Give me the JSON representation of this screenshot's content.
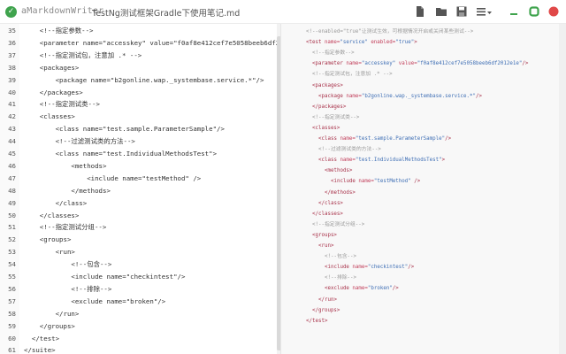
{
  "app": {
    "logo_glyph": "✓",
    "name": "aMarkdownWriter",
    "document_title": "TestNg测试框架Gradle下使用笔记.md"
  },
  "toolbar": {
    "icons": [
      "new-file-icon",
      "open-folder-icon",
      "save-icon",
      "menu-icon"
    ],
    "window_icons": [
      "minimize-icon",
      "maximize-icon",
      "close-icon"
    ]
  },
  "editor": {
    "lines": [
      {
        "n": "35",
        "text": "    <!--指定参数-->"
      },
      {
        "n": "36",
        "text": "    <parameter name=\"accesskey\" value=\"f0af8e412cef7e5058beeb6df2012"
      },
      {
        "n": "37",
        "text": "    <!--指定测试包，注意加 .* -->"
      },
      {
        "n": "38",
        "text": "    <packages>"
      },
      {
        "n": "39",
        "text": "        <package name=\"b2gonline.wap._systembase.service.*\"/>"
      },
      {
        "n": "40",
        "text": "    </packages>"
      },
      {
        "n": "41",
        "text": "    <!--指定测试类-->"
      },
      {
        "n": "42",
        "text": "    <classes>"
      },
      {
        "n": "43",
        "text": "        <class name=\"test.sample.ParameterSample\"/>"
      },
      {
        "n": "44",
        "text": "        <!--过滤测试类的方法-->"
      },
      {
        "n": "45",
        "text": "        <class name=\"test.IndividualMethodsTest\">"
      },
      {
        "n": "46",
        "text": "            <methods>"
      },
      {
        "n": "47",
        "text": "                <include name=\"testMethod\" />"
      },
      {
        "n": "48",
        "text": "            </methods>"
      },
      {
        "n": "49",
        "text": "        </class>"
      },
      {
        "n": "50",
        "text": "    </classes>"
      },
      {
        "n": "51",
        "text": "    <!--指定测试分组-->"
      },
      {
        "n": "52",
        "text": "    <groups>"
      },
      {
        "n": "53",
        "text": "        <run>"
      },
      {
        "n": "54",
        "text": "            <!--包含-->"
      },
      {
        "n": "55",
        "text": "            <include name=\"checkintest\"/>"
      },
      {
        "n": "56",
        "text": "            <!--排除-->"
      },
      {
        "n": "57",
        "text": "            <exclude name=\"broken\"/>"
      },
      {
        "n": "58",
        "text": "        </run>"
      },
      {
        "n": "59",
        "text": "    </groups>"
      },
      {
        "n": "60",
        "text": "  </test>"
      },
      {
        "n": "61",
        "text": "</suite>"
      }
    ]
  },
  "preview": {
    "lines": [
      {
        "indent": 0,
        "parts": [
          {
            "t": "<!--enabled=\"true\"让测试生效，可根据情况开启或关闭某些测试-->",
            "c": "cmt"
          }
        ]
      },
      {
        "indent": 0,
        "parts": [
          {
            "t": "<test",
            "c": "tag"
          },
          {
            "t": " name=",
            "c": "attr"
          },
          {
            "t": "\"service\"",
            "c": "val"
          },
          {
            "t": " enabled=",
            "c": "attr"
          },
          {
            "t": "\"true\"",
            "c": "val"
          },
          {
            "t": ">",
            "c": "tag"
          }
        ]
      },
      {
        "indent": 1,
        "parts": [
          {
            "t": "<!--指定参数-->",
            "c": "cmt"
          }
        ]
      },
      {
        "indent": 1,
        "parts": [
          {
            "t": "<parameter",
            "c": "tag"
          },
          {
            "t": " name=",
            "c": "attr"
          },
          {
            "t": "\"accesskey\"",
            "c": "val"
          },
          {
            "t": " value=",
            "c": "attr"
          },
          {
            "t": "\"f0af8e412cef7e5058beeb6df2012e1e\"",
            "c": "val"
          },
          {
            "t": "/>",
            "c": "tag"
          }
        ]
      },
      {
        "indent": 1,
        "parts": [
          {
            "t": "<!--指定测试包，注意加 .* -->",
            "c": "cmt"
          }
        ]
      },
      {
        "indent": 1,
        "parts": [
          {
            "t": "<packages>",
            "c": "tag"
          }
        ]
      },
      {
        "indent": 2,
        "parts": [
          {
            "t": "<package",
            "c": "tag"
          },
          {
            "t": " name=",
            "c": "attr"
          },
          {
            "t": "\"b2gonline.wap._systembase.service.*\"",
            "c": "val"
          },
          {
            "t": "/>",
            "c": "tag"
          }
        ]
      },
      {
        "indent": 1,
        "parts": [
          {
            "t": "</packages>",
            "c": "tag"
          }
        ]
      },
      {
        "indent": 1,
        "parts": [
          {
            "t": "<!--指定测试类-->",
            "c": "cmt"
          }
        ]
      },
      {
        "indent": 1,
        "parts": [
          {
            "t": "<classes>",
            "c": "tag"
          }
        ]
      },
      {
        "indent": 2,
        "parts": [
          {
            "t": "<class",
            "c": "tag"
          },
          {
            "t": " name=",
            "c": "attr"
          },
          {
            "t": "\"test.sample.ParameterSample\"",
            "c": "val"
          },
          {
            "t": "/>",
            "c": "tag"
          }
        ]
      },
      {
        "indent": 2,
        "parts": [
          {
            "t": "<!--过滤测试类的方法-->",
            "c": "cmt"
          }
        ]
      },
      {
        "indent": 2,
        "parts": [
          {
            "t": "<class",
            "c": "tag"
          },
          {
            "t": " name=",
            "c": "attr"
          },
          {
            "t": "\"test.IndividualMethodsTest\"",
            "c": "val"
          },
          {
            "t": ">",
            "c": "tag"
          }
        ]
      },
      {
        "indent": 3,
        "parts": [
          {
            "t": "<methods>",
            "c": "tag"
          }
        ]
      },
      {
        "indent": 4,
        "parts": [
          {
            "t": "<include",
            "c": "tag"
          },
          {
            "t": " name=",
            "c": "attr"
          },
          {
            "t": "\"testMethod\"",
            "c": "val"
          },
          {
            "t": " />",
            "c": "tag"
          }
        ]
      },
      {
        "indent": 3,
        "parts": [
          {
            "t": "</methods>",
            "c": "tag"
          }
        ]
      },
      {
        "indent": 2,
        "parts": [
          {
            "t": "</class>",
            "c": "tag"
          }
        ]
      },
      {
        "indent": 1,
        "parts": [
          {
            "t": "</classes>",
            "c": "tag"
          }
        ]
      },
      {
        "indent": 1,
        "parts": [
          {
            "t": "<!--指定测试分组-->",
            "c": "cmt"
          }
        ]
      },
      {
        "indent": 1,
        "parts": [
          {
            "t": "<groups>",
            "c": "tag"
          }
        ]
      },
      {
        "indent": 2,
        "parts": [
          {
            "t": "<run>",
            "c": "tag"
          }
        ]
      },
      {
        "indent": 3,
        "parts": [
          {
            "t": "<!--包含-->",
            "c": "cmt"
          }
        ]
      },
      {
        "indent": 3,
        "parts": [
          {
            "t": "<include",
            "c": "tag"
          },
          {
            "t": " name=",
            "c": "attr"
          },
          {
            "t": "\"checkintest\"",
            "c": "val"
          },
          {
            "t": "/>",
            "c": "tag"
          }
        ]
      },
      {
        "indent": 3,
        "parts": [
          {
            "t": "<!--排除-->",
            "c": "cmt"
          }
        ]
      },
      {
        "indent": 3,
        "parts": [
          {
            "t": "<exclude",
            "c": "tag"
          },
          {
            "t": " name=",
            "c": "attr"
          },
          {
            "t": "\"broken\"",
            "c": "val"
          },
          {
            "t": "/>",
            "c": "tag"
          }
        ]
      },
      {
        "indent": 2,
        "parts": [
          {
            "t": "</run>",
            "c": "tag"
          }
        ]
      },
      {
        "indent": 1,
        "parts": [
          {
            "t": "</groups>",
            "c": "tag"
          }
        ]
      },
      {
        "indent": 0,
        "parts": [
          {
            "t": "</test>",
            "c": "tag"
          }
        ]
      }
    ]
  },
  "colors": {
    "accent_green": "#3fa34d",
    "close_red": "#e04848",
    "maximize_green": "#3fa34d",
    "minimize_green": "#3fa34d",
    "tag": "#a8324a",
    "value": "#3f6fb5",
    "comment": "#9a9a9a"
  }
}
